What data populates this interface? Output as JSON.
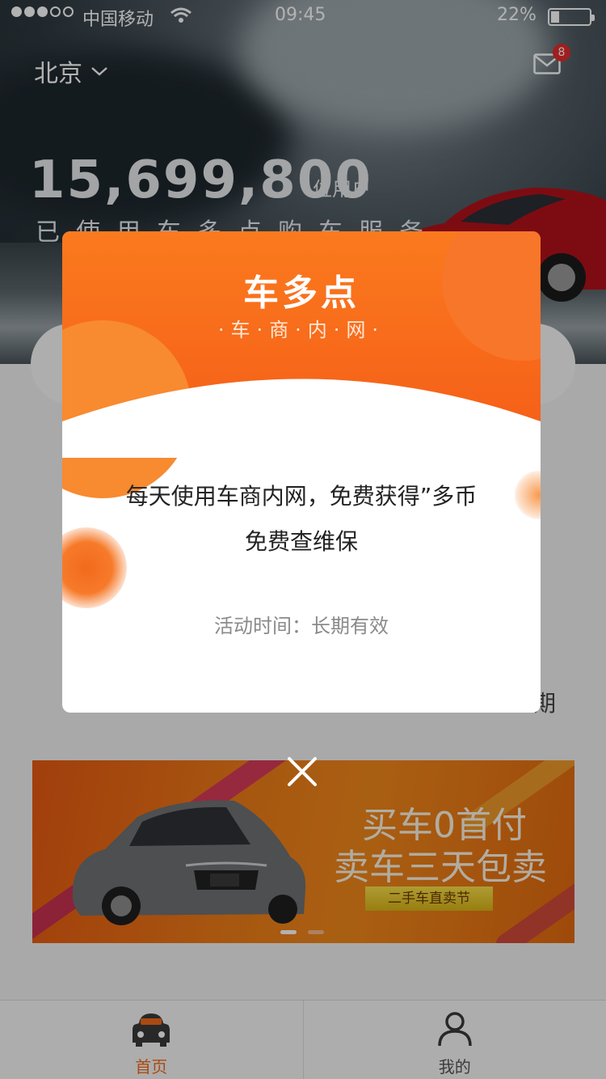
{
  "status": {
    "carrier": "中国移动",
    "time": "09:45",
    "battery_pct": "22%"
  },
  "header": {
    "city": "北京",
    "mail_badge": "8"
  },
  "hero": {
    "user_count": "15,699,800",
    "unit": "位用户",
    "slogan": "已使用车多点购车服务"
  },
  "partial_text": "期",
  "banner": {
    "line1": "买车0首付",
    "line2": "卖车三天包卖",
    "tag": "二手车直卖节",
    "active_dot": 0
  },
  "tabbar": {
    "items": [
      {
        "label": "首页",
        "icon": "car-icon",
        "active": true
      },
      {
        "label": "我的",
        "icon": "user-icon",
        "active": false
      }
    ]
  },
  "modal": {
    "brand": "车多点",
    "subtitle": "·车·商·内·网·",
    "message_line1": "每天使用车商内网，免费获得”多币",
    "message_line2": "免费查维保",
    "activity": "活动时间：长期有效"
  },
  "colors": {
    "accent": "#f26b1a",
    "modal_header": "#f86b1c"
  }
}
